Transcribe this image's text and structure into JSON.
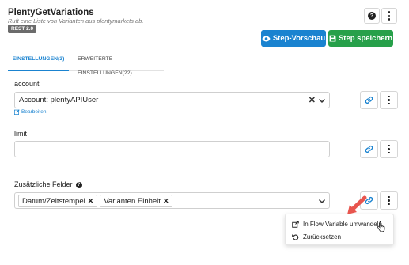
{
  "header": {
    "title": "PlentyGetVariations",
    "subtitle": "Ruft eine Liste von Varianten aus plentymarkets ab.",
    "badge": "REST 2.0",
    "help_icon": "help-circle-icon",
    "menu_icon": "kebab-menu-icon"
  },
  "actions": {
    "preview_label": "Step-Vorschau",
    "preview_icon": "eye-icon",
    "save_label": "Step speichern",
    "save_icon": "floppy-disk-icon",
    "preview_color": "#1a83d0",
    "save_color": "#27a04a"
  },
  "tabs": [
    {
      "label": "EINSTELLUNGEN(3)",
      "active": true
    },
    {
      "label": "ERWEITERTE EINSTELLUNGEN(22)",
      "active": false
    }
  ],
  "fields": {
    "account": {
      "label": "account",
      "value": "Account: plentyAPIUser",
      "edit_label": "Bearbeiten"
    },
    "limit": {
      "label": "limit",
      "value": ""
    },
    "extra_fields": {
      "label": "Zusätzliche Felder",
      "chips": [
        "Datum/Zeitstempel",
        "Varianten Einheit"
      ]
    }
  },
  "context_menu": {
    "items": [
      {
        "label": "In Flow Variable umwandeln",
        "icon": "external-link-icon"
      },
      {
        "label": "Zurücksetzen",
        "icon": "undo-icon"
      }
    ]
  },
  "colors": {
    "accent": "#1a83d0",
    "annotation_arrow": "#e8554e"
  }
}
